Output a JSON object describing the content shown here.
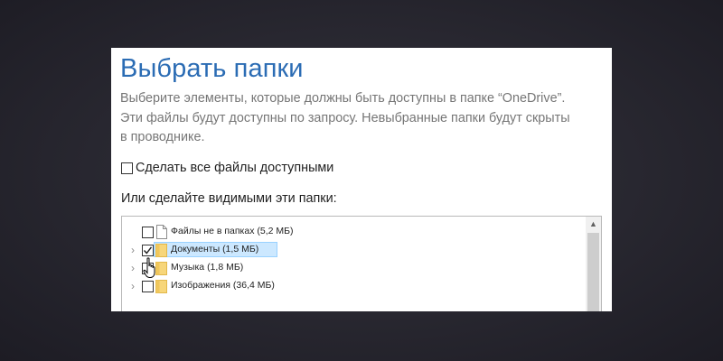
{
  "dialog": {
    "title": "Выбрать папки",
    "description_lines": [
      "Выберите элементы, которые должны быть доступны в папке “OneDrive”.",
      "Эти файлы будут доступны по запросу. Невыбранные папки будут скрыты",
      "в проводнике."
    ],
    "make_all_available": {
      "label": "Сделать все файлы доступными",
      "checked": false
    },
    "folders_label": "Или сделайте видимыми эти папки:",
    "tree": [
      {
        "label": "Файлы не в папках",
        "size": "(5,2 МБ)",
        "icon": "file-icon",
        "checked": false,
        "expandable": false,
        "selected": false
      },
      {
        "label": "Документы",
        "size": "(1,5 МБ)",
        "icon": "folder-icon",
        "checked": true,
        "expandable": true,
        "selected": true
      },
      {
        "label": "Музыка",
        "size": "(1,8 МБ)",
        "icon": "folder-icon",
        "checked": false,
        "expandable": true,
        "selected": false
      },
      {
        "label": "Изображения",
        "size": "(36,4 МБ)",
        "icon": "folder-icon",
        "checked": false,
        "expandable": true,
        "selected": false
      }
    ]
  },
  "colors": {
    "title": "#2b6cb4",
    "folder": "#f7d67a",
    "selection": "#cce8ff"
  }
}
